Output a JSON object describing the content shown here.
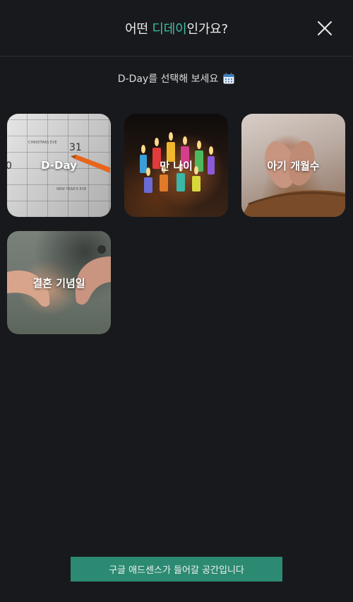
{
  "header": {
    "title_prefix": "어떤 ",
    "title_accent": "디데이",
    "title_suffix": "인가요?",
    "accent_color": "#3fc0a6",
    "close_icon": "close-icon"
  },
  "subtitle": {
    "text": "D-Day를 선택해 보세요",
    "icon": "calendar-icon"
  },
  "cards": [
    {
      "label": "D-Day"
    },
    {
      "label": "만 나이"
    },
    {
      "label": "아기 개월수"
    },
    {
      "label": "결혼 기념일"
    }
  ],
  "ad": {
    "text": "구글 애드센스가 들어갈 공간입니다",
    "color": "#2c8a73"
  },
  "colors": {
    "background": "#18191c"
  }
}
